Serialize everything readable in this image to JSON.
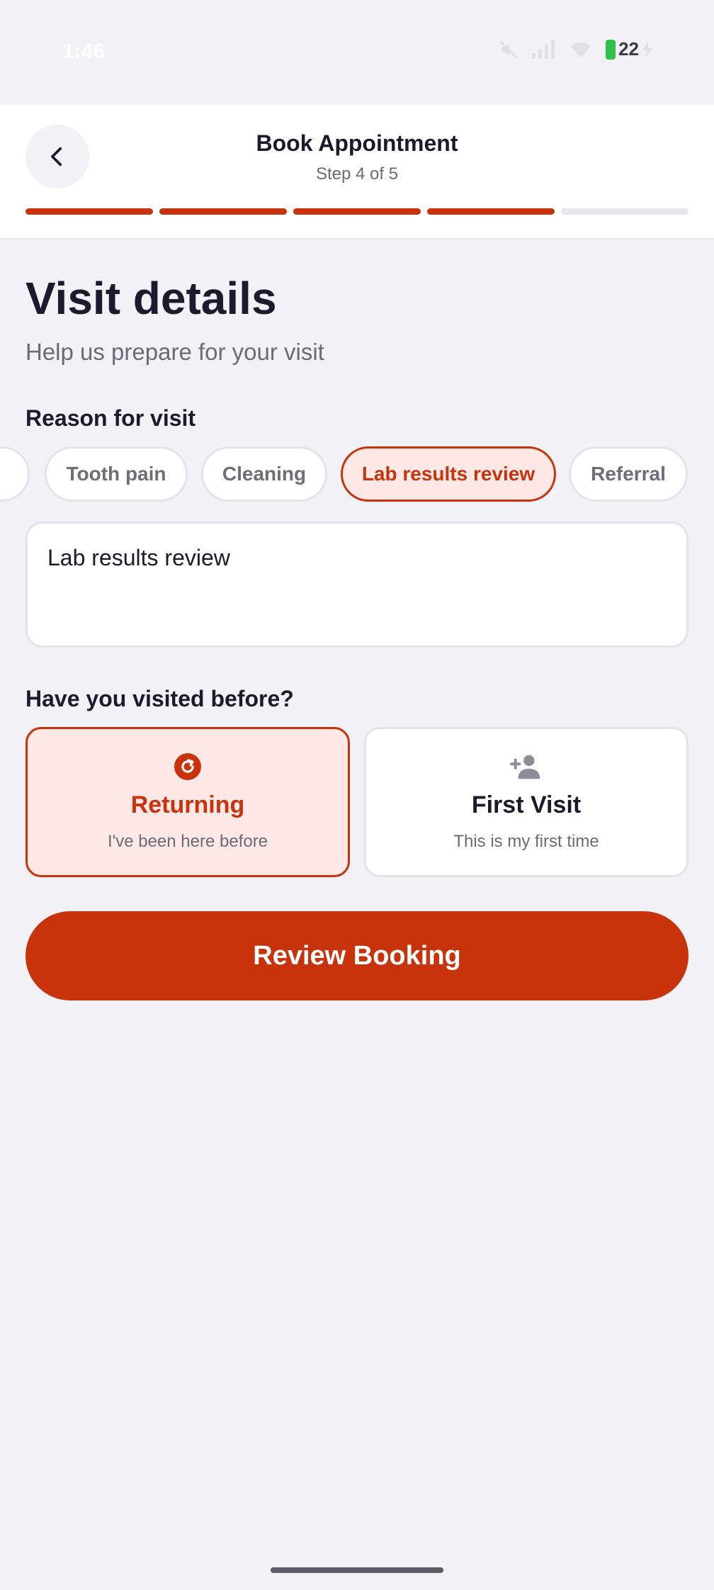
{
  "status_bar": {
    "time": "1:46",
    "battery": "22",
    "icons": [
      "mute-icon",
      "signal-icon",
      "wifi-icon",
      "battery-icon",
      "charging-icon"
    ]
  },
  "header": {
    "title": "Book Appointment",
    "step": "Step 4 of 5",
    "progress": {
      "completed": 4,
      "total": 5
    },
    "back_icon": "chevron-left-icon"
  },
  "main": {
    "title": "Visit details",
    "subtitle": "Help us prepare for your visit",
    "reason_label": "Reason for visit",
    "reason_chips": [
      {
        "label": "",
        "selected": false
      },
      {
        "label": "Tooth pain",
        "selected": false
      },
      {
        "label": "Cleaning",
        "selected": false
      },
      {
        "label": "Lab results review",
        "selected": true
      },
      {
        "label": "Referral",
        "selected": false
      }
    ],
    "reason_text": "Lab results review",
    "visited_label": "Have you visited before?",
    "visit_options": [
      {
        "title": "Returning",
        "desc": "I've been here before",
        "icon": "refresh-icon",
        "selected": true
      },
      {
        "title": "First Visit",
        "desc": "This is my first time",
        "icon": "add-person-icon",
        "selected": false
      }
    ],
    "cta_label": "Review Booking"
  },
  "colors": {
    "accent": "#c8330b",
    "accent_tint": "#fde8e5",
    "background": "#f1f1f6"
  }
}
